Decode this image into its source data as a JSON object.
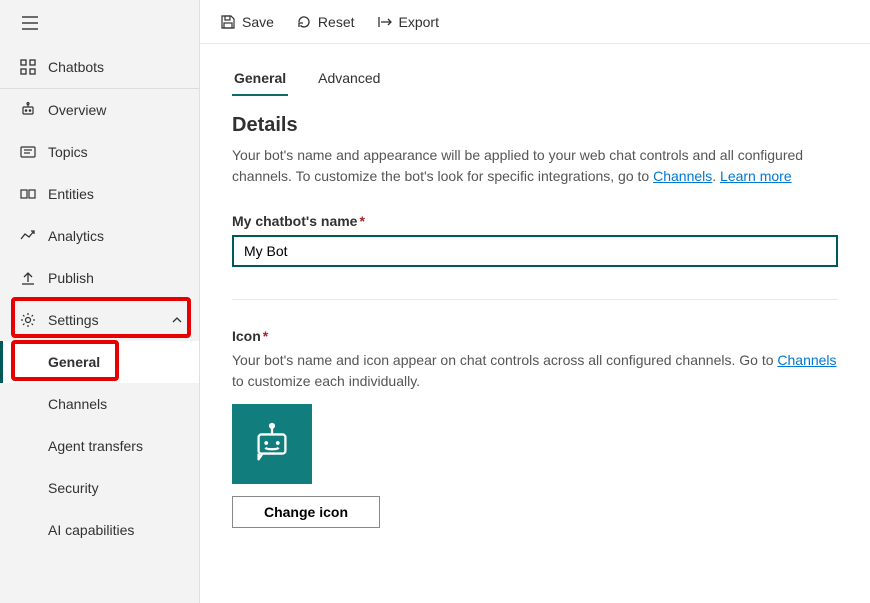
{
  "sidebar": {
    "chatbots": "Chatbots",
    "overview": "Overview",
    "topics": "Topics",
    "entities": "Entities",
    "analytics": "Analytics",
    "publish": "Publish",
    "settings": "Settings",
    "sub": {
      "general": "General",
      "channels": "Channels",
      "agent_transfers": "Agent transfers",
      "security": "Security",
      "ai_capabilities": "AI capabilities"
    }
  },
  "toolbar": {
    "save": "Save",
    "reset": "Reset",
    "export": "Export"
  },
  "tabs": {
    "general": "General",
    "advanced": "Advanced"
  },
  "details": {
    "heading": "Details",
    "desc1": "Your bot's name and appearance will be applied to your web chat controls and all configured channels. To customize the bot's look for specific integrations, go to ",
    "channels_link": "Channels",
    "sep": ". ",
    "learn_more": "Learn more",
    "name_label": "My chatbot's name",
    "name_value": "My Bot",
    "icon_label": "Icon",
    "icon_desc1": "Your bot's name and icon appear on chat controls across all configured channels. Go to ",
    "icon_channels_link": "Channels",
    "icon_desc2": " to customize each individually.",
    "change_icon": "Change icon"
  }
}
